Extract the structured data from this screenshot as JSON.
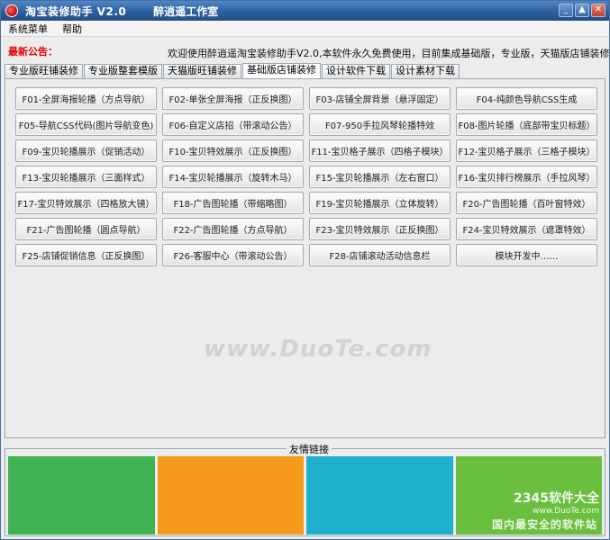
{
  "window": {
    "title": "淘宝装修助手 V2.0",
    "subtitle": "醉逍遥工作室",
    "controls": [
      "_",
      "▲",
      "✕"
    ]
  },
  "menu": {
    "items": [
      {
        "label": "系统菜单"
      },
      {
        "label": "帮助"
      }
    ]
  },
  "notice": {
    "label": "最新公告：",
    "text": "欢迎使用醉逍遥淘宝装修助手V2.0,本软件永久免费使用，目前集成基础版，专业版，天猫版店铺装修功能，内置"
  },
  "tabs": [
    {
      "label": "专业版旺铺装修",
      "active": false
    },
    {
      "label": "专业版整套模版",
      "active": false
    },
    {
      "label": "天猫版旺铺装修",
      "active": false
    },
    {
      "label": "基础版店铺装修",
      "active": true
    },
    {
      "label": "设计软件下载",
      "active": false
    },
    {
      "label": "设计素材下载",
      "active": false
    }
  ],
  "buttons": [
    "F01-全屏海报轮播（方点导航）",
    "F02-单张全屏海报（正反换图）",
    "F03-店铺全屏背景（悬浮固定）",
    "F04-纯颜色导航CSS生成",
    "F05-导航CSS代码(图片导航变色)",
    "F06-自定义店招（带滚动公告）",
    "F07-950手拉风琴轮播特效",
    "F08-图片轮播（底部带宝贝标题）",
    "F09-宝贝轮播展示（促销活动）",
    "F10-宝贝特效展示（正反换图）",
    "F11-宝贝格子展示（四格子模块）",
    "F12-宝贝格子展示（三格子模块）",
    "F13-宝贝轮播展示（三面样式）",
    "F14-宝贝轮播展示（旋转木马）",
    "F15-宝贝轮播展示（左右窗口）",
    "F16-宝贝排行榜展示（手拉风琴）",
    "F17-宝贝特效展示（四格放大镜）",
    "F18-广告图轮播（带缩略图）",
    "F19-宝贝轮播展示（立体旋转）",
    "F20-广告图轮播（百叶窗特效）",
    "F21-广告图轮播（圆点导航）",
    "F22-广告图轮播（方点导航）",
    "F23-宝贝特效展示（正反换图）",
    "F24-宝贝特效展示（遮罩特效）",
    "F25-店铺促销信息（正反换图）",
    "F26-客服中心（带滚动公告）",
    "F28-店铺滚动活动信息栏",
    "模块开发中……"
  ],
  "watermark": "www.DuoTe.com",
  "links": {
    "title": "友情链接",
    "tiles": [
      {
        "color": "#3fb251"
      },
      {
        "color": "#f59a1a"
      },
      {
        "color": "#1eb0cc"
      },
      {
        "color": "#6abf3f"
      }
    ],
    "corner_logo": "2345软件大全",
    "corner_url": "www.DuoTe.com",
    "corner_slogan": "国内最安全的软件站"
  }
}
